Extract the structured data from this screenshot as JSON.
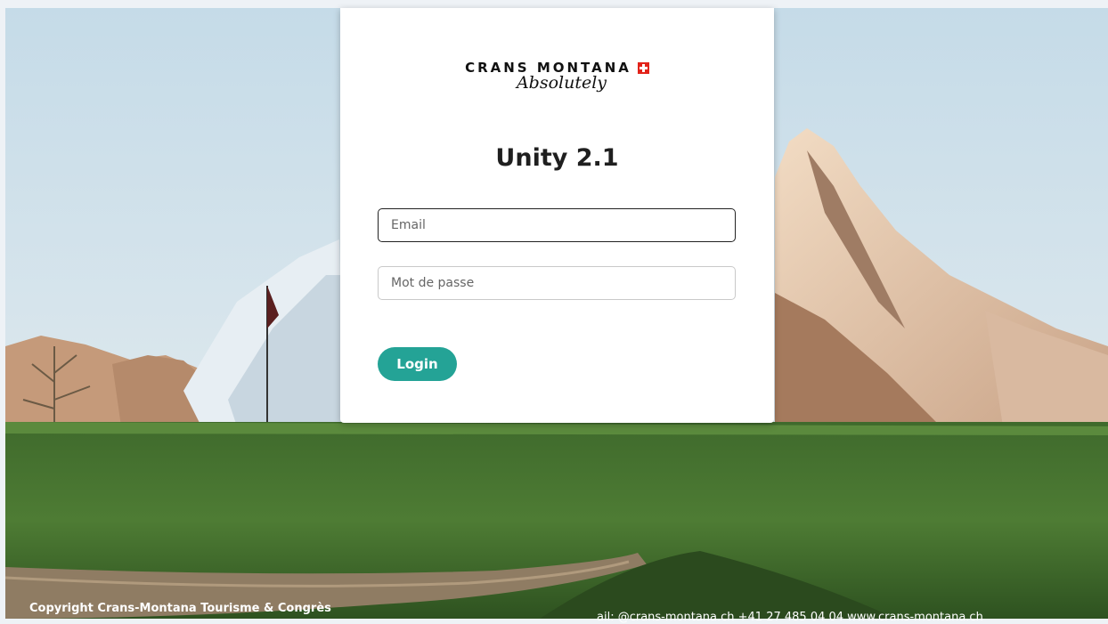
{
  "brand": {
    "name": "CRANS MONTANA",
    "tagline": "Absolutely",
    "flag_icon": "swiss-flag-icon"
  },
  "app_title": "Unity 2.1",
  "form": {
    "email_placeholder": "Email",
    "password_placeholder": "Mot de passe",
    "login_label": "Login"
  },
  "footer": {
    "copyright": "Copyright Crans-Montana Tourisme & Congrès",
    "contact_partial": "ail: @crans-montana.ch   +41 27 485 04 04   www.crans-montana.ch"
  },
  "colors": {
    "accent": "#24a396",
    "flag_red": "#e2231a",
    "page_bg": "#eef2f6"
  }
}
